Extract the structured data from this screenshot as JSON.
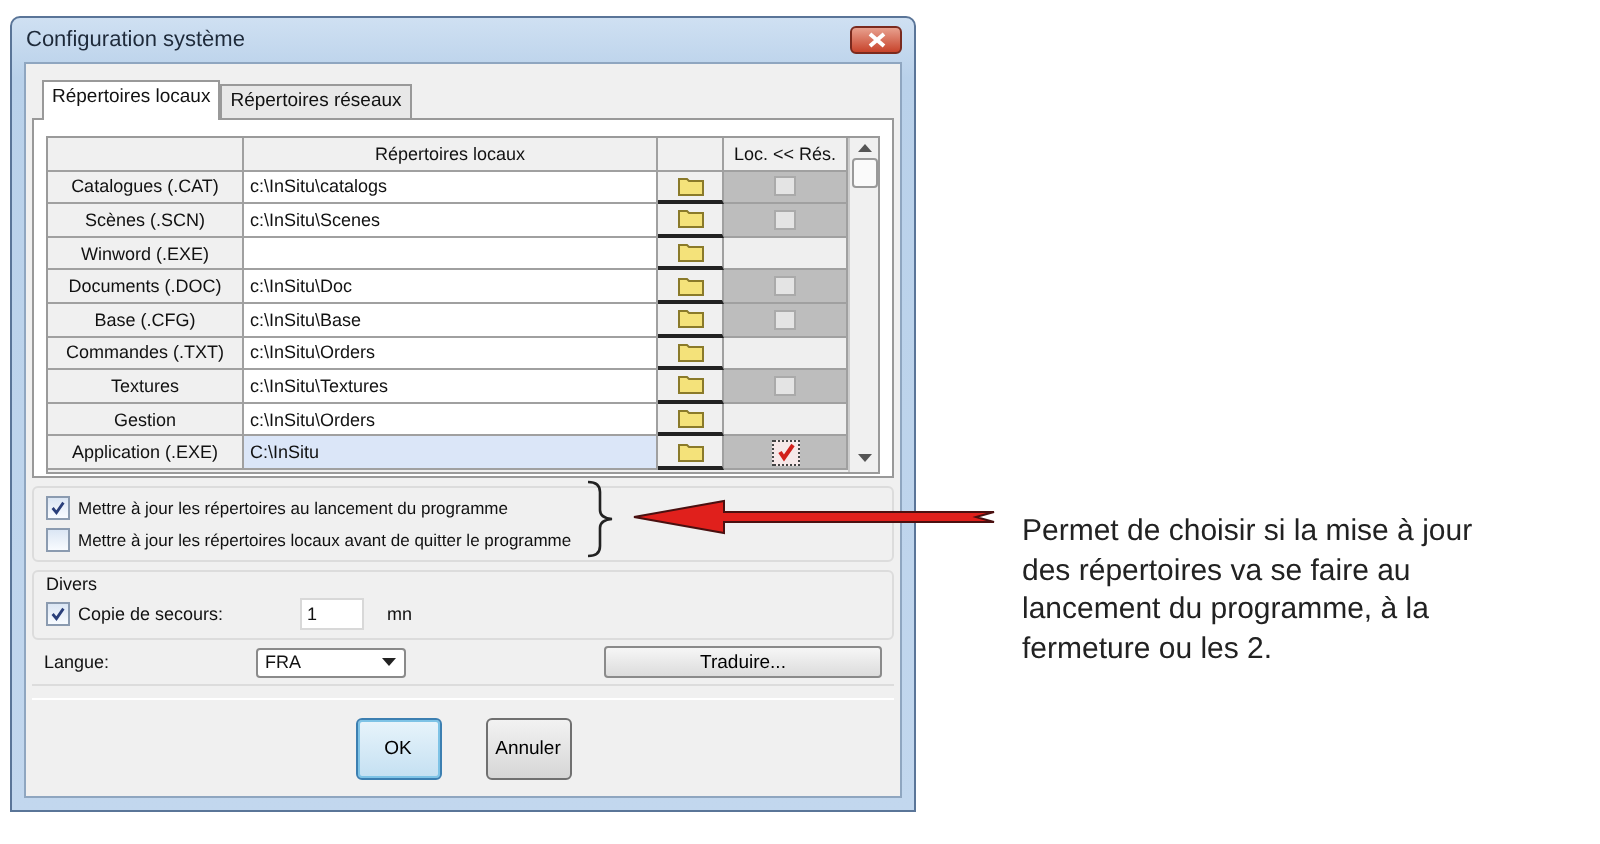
{
  "window": {
    "title": "Configuration système"
  },
  "tabs": [
    {
      "label": "Répertoires locaux",
      "selected": true
    },
    {
      "label": "Répertoires réseaux",
      "selected": false
    }
  ],
  "grid": {
    "path_header": "Répertoires locaux",
    "sync_header": "Loc. << Rés.",
    "rows": [
      {
        "label": "Catalogues (.CAT)",
        "path": "c:\\InSitu\\catalogs",
        "selected": false,
        "sync": {
          "kind": "checkbox",
          "checked": false
        }
      },
      {
        "label": "Scènes (.SCN)",
        "path": "c:\\InSitu\\Scenes",
        "selected": false,
        "sync": {
          "kind": "checkbox",
          "checked": false
        }
      },
      {
        "label": "Winword (.EXE)",
        "selected": false,
        "sync": {
          "kind": "none"
        }
      },
      {
        "label": "Documents (.DOC)",
        "path": "c:\\InSitu\\Doc",
        "selected": false,
        "sync": {
          "kind": "checkbox",
          "checked": false
        }
      },
      {
        "label": "Base (.CFG)",
        "path": "c:\\InSitu\\Base",
        "selected": false,
        "sync": {
          "kind": "checkbox",
          "checked": false
        }
      },
      {
        "label": "Commandes (.TXT)",
        "path": "c:\\InSitu\\Orders",
        "selected": false,
        "sync": {
          "kind": "none"
        }
      },
      {
        "label": "Textures",
        "path": "c:\\InSitu\\Textures",
        "selected": false,
        "sync": {
          "kind": "checkbox",
          "checked": false
        }
      },
      {
        "label": "Gestion",
        "path": "c:\\InSitu\\Orders",
        "selected": false,
        "sync": {
          "kind": "none"
        }
      },
      {
        "label": "Application (.EXE)",
        "path": "C:\\InSitu",
        "selected": true,
        "sync": {
          "kind": "checkbox",
          "checked": true
        }
      }
    ]
  },
  "options": [
    {
      "label": "Mettre à jour les répertoires au lancement du programme",
      "checked": true
    },
    {
      "label": "Mettre à jour les répertoires locaux avant de quitter le programme",
      "checked": false
    }
  ],
  "divers": {
    "title": "Divers",
    "backup": {
      "label": "Copie de secours:",
      "checked": true,
      "value": "1",
      "unit": "mn"
    }
  },
  "language": {
    "label": "Langue:",
    "value": "FRA"
  },
  "translate_button": "Traduire...",
  "buttons": [
    {
      "label": "OK",
      "default": true
    },
    {
      "label": "Annuler",
      "default": false
    }
  ],
  "annotation": "Permet de choisir si la mise à jour des répertoires va se faire au lancement du programme, à la fermeture ou les 2."
}
